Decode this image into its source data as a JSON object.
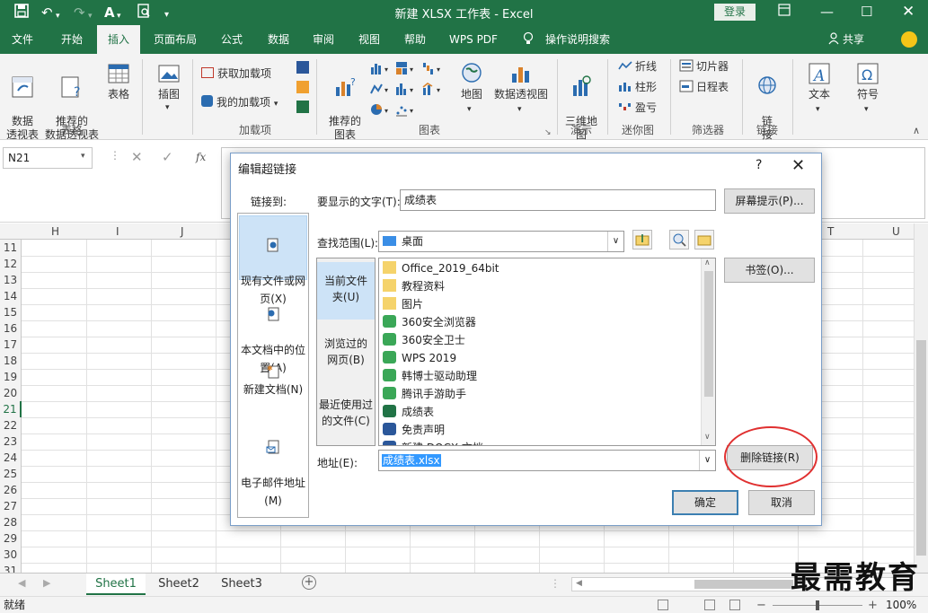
{
  "titlebar": {
    "title": "新建 XLSX 工作表 - Excel",
    "login": "登录"
  },
  "tabs": [
    "文件",
    "开始",
    "插入",
    "页面布局",
    "公式",
    "数据",
    "审阅",
    "视图",
    "帮助",
    "WPS PDF"
  ],
  "tab_tellme": "操作说明搜索",
  "tab_share": "共享",
  "ribbon": {
    "pivot": "数据\n透视表",
    "rec_pivot": "推荐的\n数据透视表",
    "table": "表格",
    "illustrations": "插图",
    "get_addins": "获取加载项",
    "my_addins": "我的加载项",
    "rec_charts": "推荐的\n图表",
    "map": "地图",
    "pivot_chart": "数据透视图",
    "map3d": "三维地\n图",
    "line": "折线",
    "column": "柱形",
    "winloss": "盈亏",
    "slicer": "切片器",
    "timeline": "日程表",
    "link": "链\n接",
    "text": "文本",
    "symbol": "符号",
    "groups": {
      "tables": "表格",
      "addins": "加载项",
      "charts": "图表",
      "tours": "演示",
      "sparklines": "迷你图",
      "filters": "筛选器",
      "links": "链接"
    }
  },
  "formula": {
    "namebox": "N21",
    "fx": "fx"
  },
  "grid": {
    "columns_left": [
      "H",
      "I",
      "J"
    ],
    "columns_right": [
      "T",
      "U"
    ],
    "rows": [
      "11",
      "12",
      "13",
      "14",
      "15",
      "16",
      "17",
      "18",
      "19",
      "20",
      "21",
      "22",
      "23",
      "24",
      "25",
      "26",
      "27",
      "28",
      "29",
      "30",
      "31"
    ]
  },
  "sheets": [
    "Sheet1",
    "Sheet2",
    "Sheet3"
  ],
  "status": {
    "ready": "就绪",
    "zoom": "100%"
  },
  "watermark": "最需教育",
  "dialog": {
    "title": "编辑超链接",
    "help": "?",
    "link_to_label": "链接到:",
    "link_to_items": [
      "现有文件或网\n页(X)",
      "本文档中的位\n置(A)",
      "新建文档(N)",
      "电子邮件地址\n(M)"
    ],
    "display_text_label": "要显示的文字(T):",
    "display_text_value": "成绩表",
    "screentip_button": "屏幕提示(P)...",
    "lookin_label": "查找范围(L):",
    "lookin_value": "桌面",
    "nav_items": [
      "当前文件\n夹(U)",
      "浏览过的\n网页(B)",
      "最近使用过\n的文件(C)"
    ],
    "files": [
      {
        "name": "Office_2019_64bit",
        "icon": "folder-icon"
      },
      {
        "name": "教程资料",
        "icon": "folder-icon"
      },
      {
        "name": "图片",
        "icon": "folder-icon"
      },
      {
        "name": "360安全浏览器",
        "icon": "app-icon"
      },
      {
        "name": "360安全卫士",
        "icon": "app-icon"
      },
      {
        "name": "WPS 2019",
        "icon": "app-icon"
      },
      {
        "name": "韩博士驱动助理",
        "icon": "app-icon"
      },
      {
        "name": "腾讯手游助手",
        "icon": "app-icon"
      },
      {
        "name": "成绩表",
        "icon": "excel-file-icon"
      },
      {
        "name": "免责声明",
        "icon": "word-file-icon"
      },
      {
        "name": "新建 DOCX 文档",
        "icon": "word-file-icon"
      }
    ],
    "bookmark_button": "书签(O)...",
    "address_label": "地址(E):",
    "address_value": "成绩表.xlsx",
    "remove_link_button": "删除链接(R)",
    "ok_button": "确定",
    "cancel_button": "取消"
  }
}
